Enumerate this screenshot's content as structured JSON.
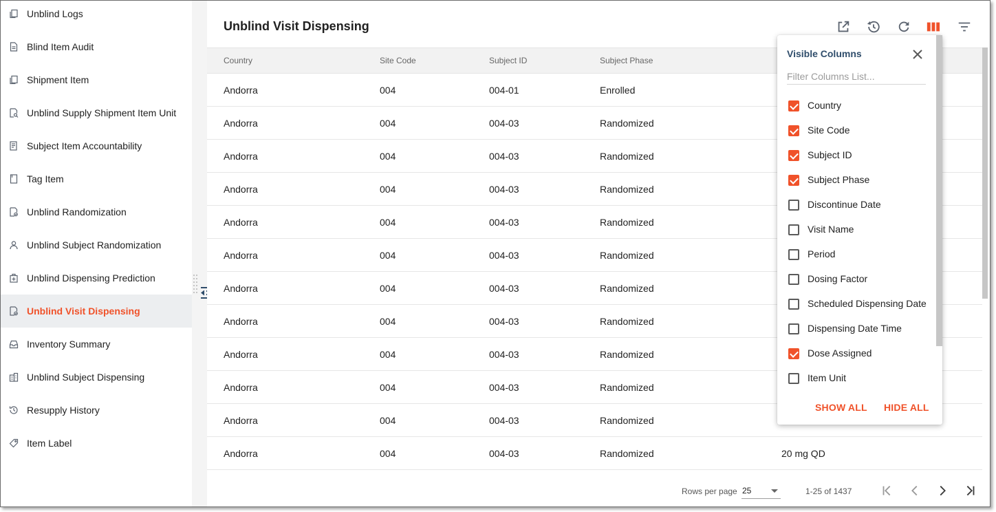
{
  "sidebar": {
    "items": [
      {
        "label": "Unblind Logs",
        "icon": "copy-icon",
        "active": false
      },
      {
        "label": "Blind Item Audit",
        "icon": "document-icon",
        "active": false
      },
      {
        "label": "Shipment Item",
        "icon": "copy-icon",
        "active": false
      },
      {
        "label": "Unblind Supply Shipment Item Unit",
        "icon": "document-search-icon",
        "active": false
      },
      {
        "label": "Subject Item Accountability",
        "icon": "report-icon",
        "active": false
      },
      {
        "label": "Tag Item",
        "icon": "page-icon",
        "active": false
      },
      {
        "label": "Unblind Randomization",
        "icon": "document-check-icon",
        "active": false
      },
      {
        "label": "Unblind Subject Randomization",
        "icon": "person-icon",
        "active": false
      },
      {
        "label": "Unblind Dispensing Prediction",
        "icon": "medical-kit-icon",
        "active": false
      },
      {
        "label": "Unblind Visit Dispensing",
        "icon": "document-check-icon",
        "active": true
      },
      {
        "label": "Inventory Summary",
        "icon": "inbox-icon",
        "active": false
      },
      {
        "label": "Unblind Subject Dispensing",
        "icon": "building-icon",
        "active": false
      },
      {
        "label": "Resupply History",
        "icon": "history-icon",
        "active": false
      },
      {
        "label": "Item Label",
        "icon": "tag-icon",
        "active": false
      }
    ]
  },
  "main": {
    "title": "Unblind Visit Dispensing",
    "toolbar": [
      "open-new-window-icon",
      "history-icon",
      "refresh-icon",
      "columns-icon",
      "filter-icon"
    ],
    "columns": [
      "Country",
      "Site Code",
      "Subject ID",
      "Subject Phase"
    ],
    "rows": [
      {
        "country": "Andorra",
        "site": "004",
        "subject": "004-01",
        "phase": "Enrolled",
        "extra": ""
      },
      {
        "country": "Andorra",
        "site": "004",
        "subject": "004-03",
        "phase": "Randomized",
        "extra": ""
      },
      {
        "country": "Andorra",
        "site": "004",
        "subject": "004-03",
        "phase": "Randomized",
        "extra": ""
      },
      {
        "country": "Andorra",
        "site": "004",
        "subject": "004-03",
        "phase": "Randomized",
        "extra": ""
      },
      {
        "country": "Andorra",
        "site": "004",
        "subject": "004-03",
        "phase": "Randomized",
        "extra": ""
      },
      {
        "country": "Andorra",
        "site": "004",
        "subject": "004-03",
        "phase": "Randomized",
        "extra": ""
      },
      {
        "country": "Andorra",
        "site": "004",
        "subject": "004-03",
        "phase": "Randomized",
        "extra": ""
      },
      {
        "country": "Andorra",
        "site": "004",
        "subject": "004-03",
        "phase": "Randomized",
        "extra": ""
      },
      {
        "country": "Andorra",
        "site": "004",
        "subject": "004-03",
        "phase": "Randomized",
        "extra": ""
      },
      {
        "country": "Andorra",
        "site": "004",
        "subject": "004-03",
        "phase": "Randomized",
        "extra": ""
      },
      {
        "country": "Andorra",
        "site": "004",
        "subject": "004-03",
        "phase": "Randomized",
        "extra": ""
      },
      {
        "country": "Andorra",
        "site": "004",
        "subject": "004-03",
        "phase": "Randomized",
        "extra": "20 mg QD"
      }
    ],
    "pagination": {
      "rows_per_page_label": "Rows per page",
      "rows_per_page": "25",
      "range": "1-25 of 1437"
    }
  },
  "column_picker": {
    "title": "Visible Columns",
    "filter_placeholder": "Filter Columns List...",
    "options": [
      {
        "label": "Country",
        "checked": true
      },
      {
        "label": "Site Code",
        "checked": true
      },
      {
        "label": "Subject ID",
        "checked": true
      },
      {
        "label": "Subject Phase",
        "checked": true
      },
      {
        "label": "Discontinue Date",
        "checked": false
      },
      {
        "label": "Visit Name",
        "checked": false
      },
      {
        "label": "Period",
        "checked": false
      },
      {
        "label": "Dosing Factor",
        "checked": false
      },
      {
        "label": "Scheduled Dispensing Date",
        "checked": false
      },
      {
        "label": "Dispensing Date Time",
        "checked": false
      },
      {
        "label": "Dose Assigned",
        "checked": true
      },
      {
        "label": "Item Unit",
        "checked": false
      }
    ],
    "show_all_label": "SHOW ALL",
    "hide_all_label": "HIDE ALL"
  },
  "colors": {
    "accent": "#f0522a",
    "title_blue": "#2f4d6b",
    "active_bg": "#eceef0"
  }
}
